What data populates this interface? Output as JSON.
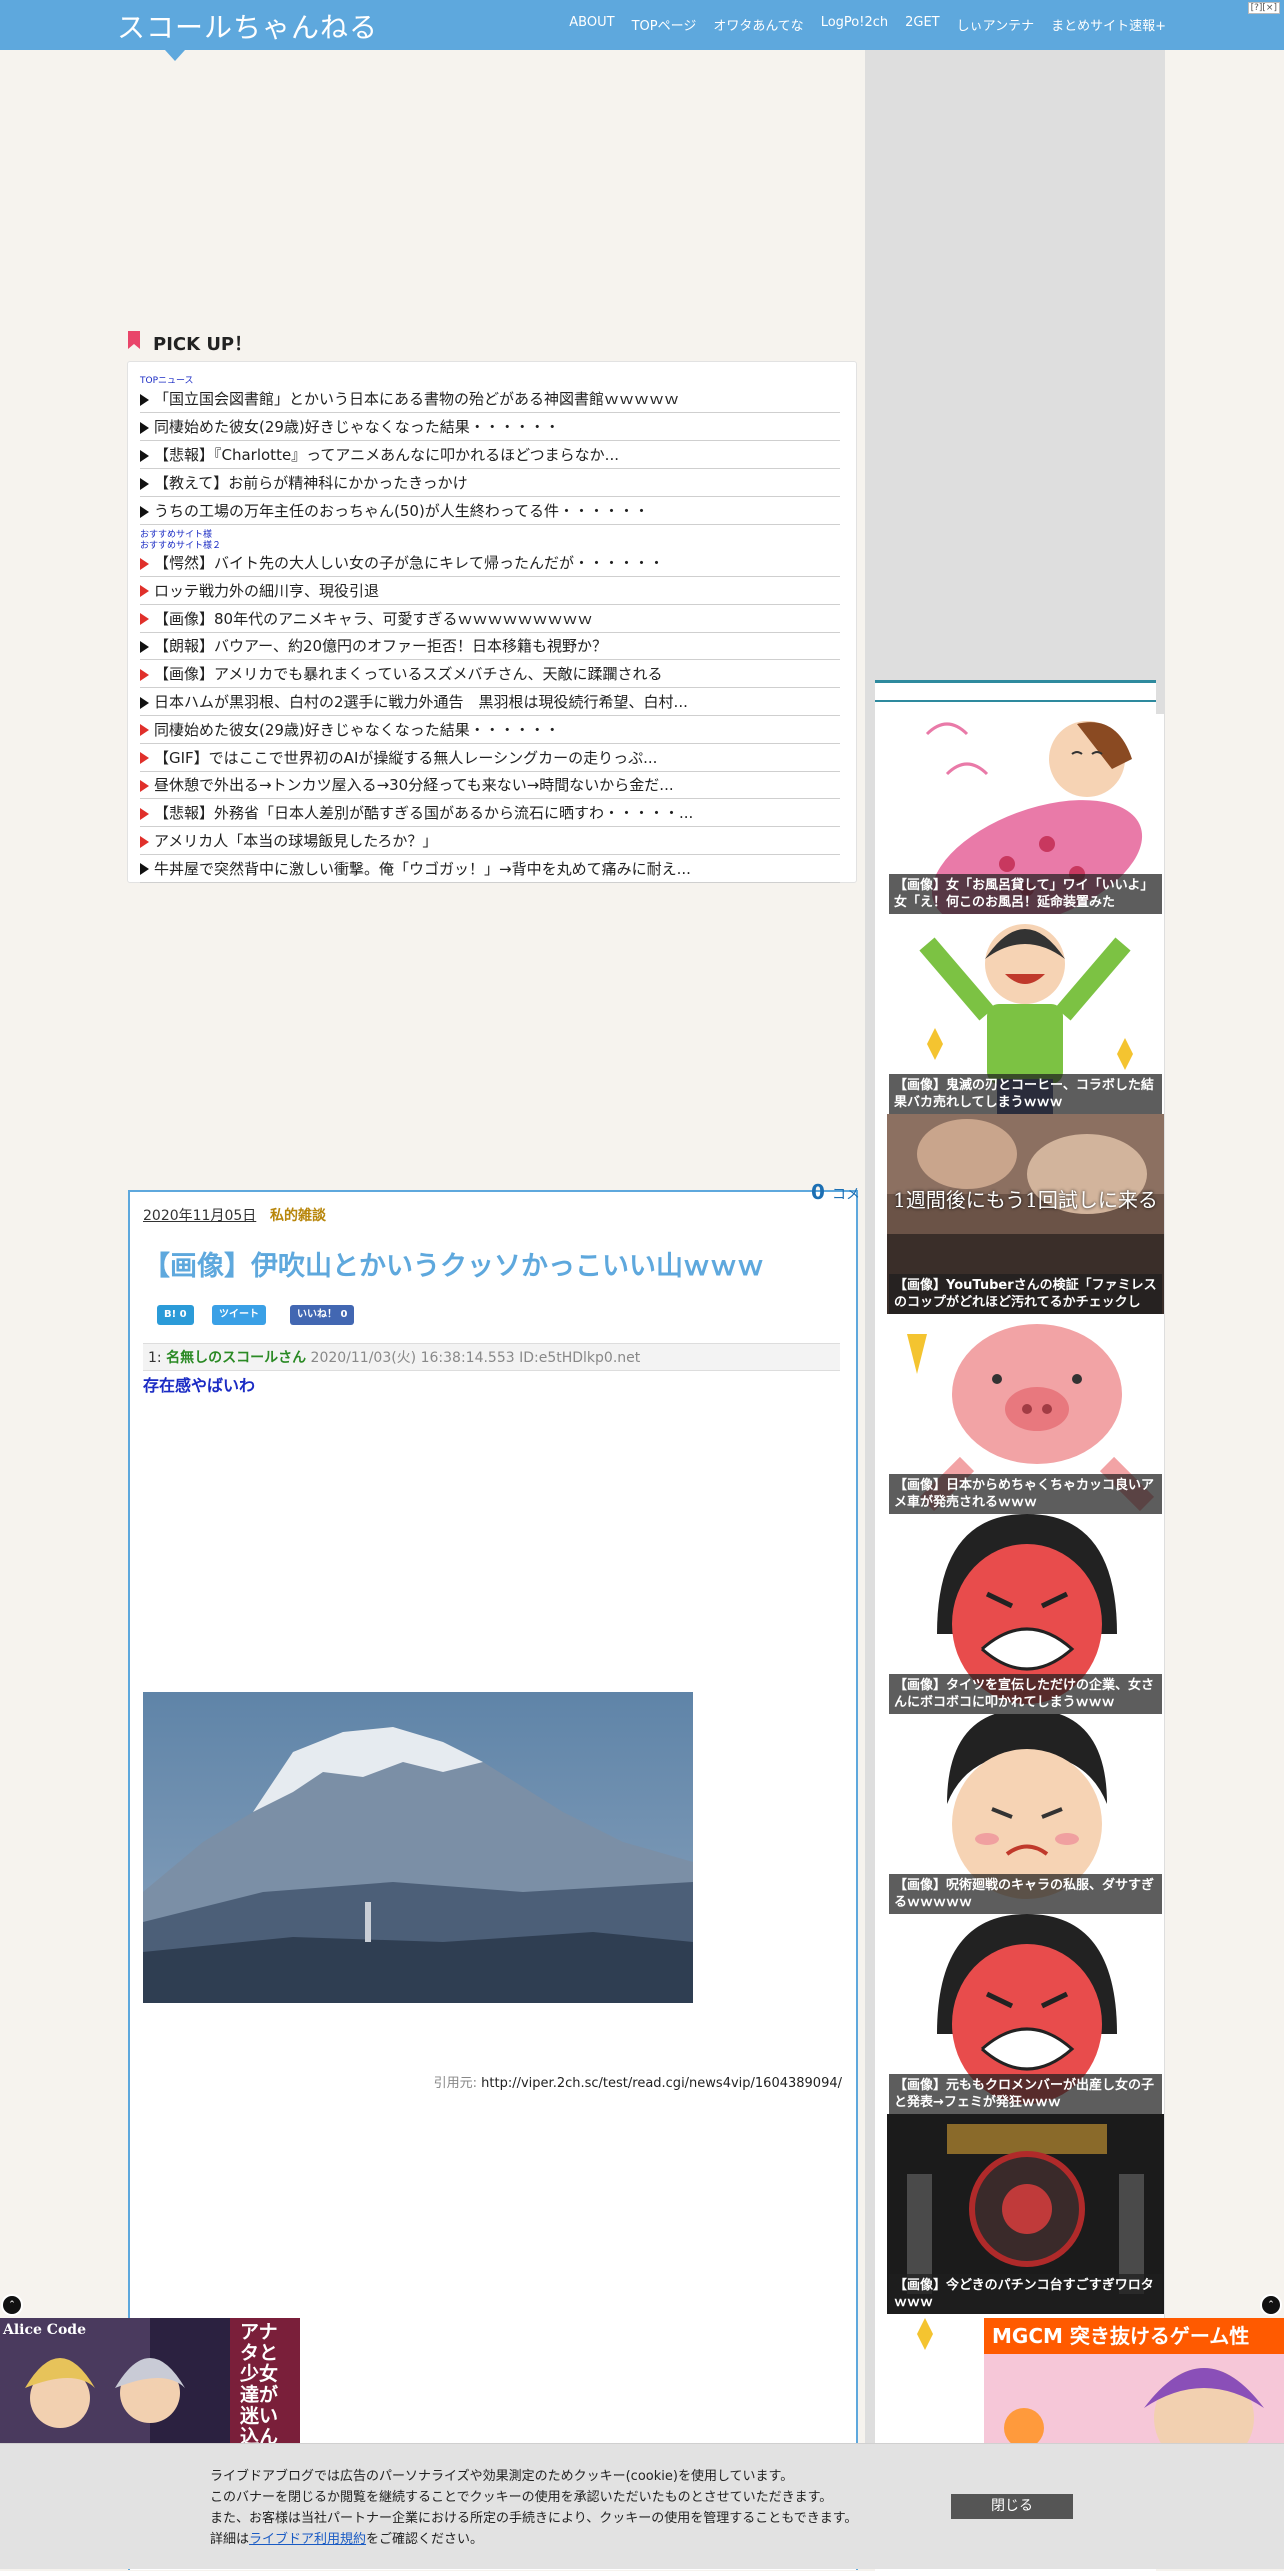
{
  "header": {
    "site_title": "スコールちゃんねる",
    "nav": [
      "ABOUT",
      "TOPページ",
      "オワタあんてな",
      "LogPo!2ch",
      "2GET",
      "しぃアンテナ",
      "まとめサイト速報+"
    ],
    "corner_tag": "[?][×]"
  },
  "pickup": {
    "title": "PICK UP！",
    "label_top": "TOPニュース",
    "label_rec1": "おすすめサイト様",
    "label_rec2": "おすすめサイト様２",
    "items_top": [
      "「国立国会図書館」とかいう日本にある書物の殆どがある神図書館ｗｗｗｗｗ",
      "同棲始めた彼女(29歳)好きじゃなくなった結果・・・・・・",
      "【悲報】『Charlotte』ってアニメあんなに叩かれるほどつまらなか...",
      "【教えて】お前らが精神科にかかったきっかけ",
      "うちの工場の万年主任のおっちゃん(50)が人生終わってる件・・・・・・"
    ],
    "items_rec": [
      "【愕然】バイト先の大人しい女の子が急にキレて帰ったんだが・・・・・・",
      "ロッテ戦力外の細川亨、現役引退",
      "【画像】80年代のアニメキャラ、可愛すぎるｗｗｗｗｗｗｗｗｗ",
      "【朗報】バウアー、約20億円のオファー拒否！日本移籍も視野か？",
      "【画像】アメリカでも暴れまくっているスズメバチさん、天敵に蹂躙される",
      "日本ハムが黒羽根、白村の2選手に戦力外通告　黒羽根は現役続行希望、白村...",
      "同棲始めた彼女(29歳)好きじゃなくなった結果・・・・・・",
      "【GIF】ではここで世界初のAIが操縦する無人レーシングカーの走りっぷ...",
      "昼休憩で外出る→トンカツ屋入る→30分経っても来ない→時間ないから金だ...",
      "【悲報】外務省「日本人差別が酷すぎる国があるから流石に晒すわ・・・・・...",
      "アメリカ人「本当の球場飯見したろか？」",
      "牛丼屋で突然背中に激しい衝撃。俺「ウゴガッ！」→背中を丸めて痛みに耐え..."
    ],
    "rec_triangle_colors": [
      "red",
      "red",
      "red",
      "black",
      "red",
      "black",
      "red",
      "red",
      "red",
      "red",
      "red",
      "black"
    ]
  },
  "article": {
    "comment_count": "0",
    "comment_label": "コメ",
    "date": "2020年11月05日",
    "category": "私的雑談",
    "title": "【画像】伊吹山とかいうクッソかっこいい山ｗｗｗ",
    "share_hatena": "B! 0",
    "share_tweet": "ツイート",
    "share_like": "いいね！ 0",
    "res_num": "1:",
    "res_name": "名無しのスコールさん",
    "res_meta": "2020/11/03(火) 16:38:14.553 ID:e5tHDlkp0.net",
    "res_body": "存在感やばいわ",
    "source_label": "引用元:",
    "source_url": "http://viper.2ch.sc/test/read.cgi/news4vip/1604389094/"
  },
  "sidebar": {
    "cards": [
      {
        "caption": "【画像】女「お風呂貸して」ワイ「いいよ」女「え！何このお風呂！延命装置みた",
        "icon": "baby-bath-illustration"
      },
      {
        "caption": "【画像】鬼滅の刃とコーヒー、コラボした結果バカ売れしてしまうｗｗｗ",
        "icon": "happy-boy-illustration"
      },
      {
        "caption": "【画像】YouTuberさんの検証「ファミレスのコップがどれほど汚れてるかチェックし",
        "icon": "video-still",
        "overlay": "1週間後にもう1回試しに来る"
      },
      {
        "caption": "【画像】日本からめちゃくちゃカッコ良いアメ車が発売されるｗｗｗ",
        "icon": "pig-illustration"
      },
      {
        "caption": "【画像】タイツを宣伝しただけの企業、女さんにボコボコに叩かれてしまうｗｗｗ",
        "icon": "angry-woman-illustration"
      },
      {
        "caption": "【画像】呪術廻戦のキャラの私服、ダサすぎるｗｗｗｗｗ",
        "icon": "upset-boy-illustration"
      },
      {
        "caption": "【画像】元ももクロメンバーが出産し女の子と発表→フェミが発狂ｗｗｗ",
        "icon": "angry-woman-illustration"
      },
      {
        "caption": "【画像】今どきのパチンコ台すごすぎワロタｗｗｗ",
        "icon": "pachinko-machine"
      }
    ]
  },
  "ads": {
    "left_text": "アナタと少女達が迷い込ん",
    "left_logo": "Alice Code",
    "right_banner": "MGCM 突き抜けるゲーム性"
  },
  "cookie": {
    "lines": [
      "ライブドアブログでは広告のパーソナライズや効果測定のためクッキー(cookie)を使用しています。",
      "このバナーを閉じるか閲覧を継続することでクッキーの使用を承認いただいたものとさせていただきます。",
      "また、お客様は当社パートナー企業における所定の手続きにより、クッキーの使用を管理することもできます。"
    ],
    "line4_prefix": "詳細は",
    "line4_link": "ライブドア利用規約",
    "line4_suffix": "をご確認ください。",
    "close_label": "閉じる"
  },
  "colors": {
    "header": "#5ea8dd",
    "accent_teal": "#2e8a9e",
    "title_blue": "#5ea8dd",
    "name_green": "#2a8a24",
    "body_blue": "#1a2bc4",
    "category_gold": "#b8860b",
    "bookmark_pink": "#e9456a"
  }
}
